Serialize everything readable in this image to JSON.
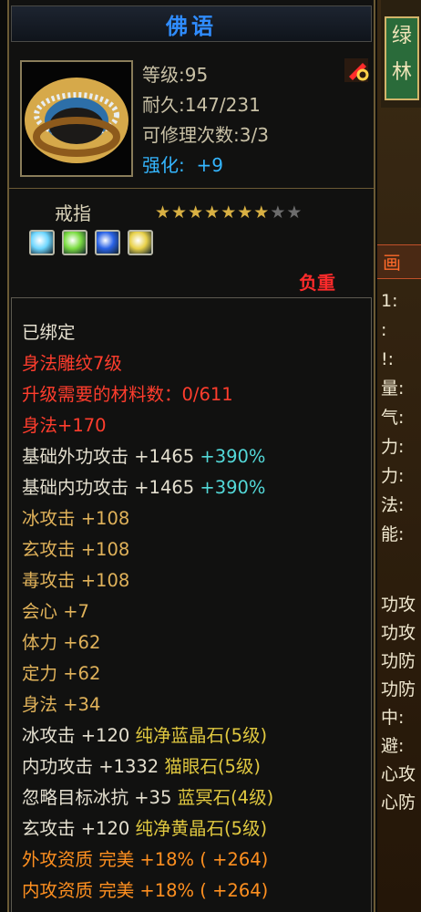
{
  "window": {
    "title": "佛语"
  },
  "item": {
    "level": "等级:95",
    "durability": "耐久:147/231",
    "repair_count": "可修理次数:3/3",
    "enhance_label": "强化:",
    "enhance_value": "+9",
    "type": "戒指",
    "stars": {
      "filled": 7,
      "total": 9
    },
    "bound_status": "负重",
    "gems": [
      {
        "name": "ice-gem-icon",
        "color": "#6fd7ff"
      },
      {
        "name": "green-gem-icon",
        "color": "#7bdc42"
      },
      {
        "name": "blue-gem-icon",
        "color": "#2a63e6"
      },
      {
        "name": "yellow-gem-icon",
        "color": "#e8d14a"
      }
    ]
  },
  "attributes": [
    {
      "parts": [
        {
          "text": "已绑定",
          "color": "w"
        }
      ]
    },
    {
      "parts": [
        {
          "text": "身法雕纹7级",
          "color": "r"
        }
      ]
    },
    {
      "parts": [
        {
          "text": "升级需要的材料数：0/611",
          "color": "r"
        }
      ]
    },
    {
      "parts": [
        {
          "text": "身法+170",
          "color": "r"
        }
      ]
    },
    {
      "parts": [
        {
          "text": "基础外功攻击 +1465 ",
          "color": "w"
        },
        {
          "text": "+390%",
          "color": "c"
        }
      ]
    },
    {
      "parts": [
        {
          "text": "基础内功攻击 +1465 ",
          "color": "w"
        },
        {
          "text": "+390%",
          "color": "c"
        }
      ]
    },
    {
      "parts": [
        {
          "text": "冰攻击 +108",
          "color": "y"
        }
      ]
    },
    {
      "parts": [
        {
          "text": "玄攻击 +108",
          "color": "y"
        }
      ]
    },
    {
      "parts": [
        {
          "text": "毒攻击 +108",
          "color": "y"
        }
      ]
    },
    {
      "parts": [
        {
          "text": "会心 +7",
          "color": "y"
        }
      ]
    },
    {
      "parts": [
        {
          "text": "体力 +62",
          "color": "y"
        }
      ]
    },
    {
      "parts": [
        {
          "text": "定力 +62",
          "color": "y"
        }
      ]
    },
    {
      "parts": [
        {
          "text": "身法 +34",
          "color": "y"
        }
      ]
    },
    {
      "parts": [
        {
          "text": "冰攻击 +120 ",
          "color": "w"
        },
        {
          "text": "纯净蓝晶石(5级)",
          "color": "g"
        }
      ]
    },
    {
      "parts": [
        {
          "text": "内功攻击 +1332 ",
          "color": "w"
        },
        {
          "text": "猫眼石(5级)",
          "color": "g"
        }
      ]
    },
    {
      "parts": [
        {
          "text": "忽略目标冰抗 +35 ",
          "color": "w"
        },
        {
          "text": "蓝冥石(4级)",
          "color": "g"
        }
      ]
    },
    {
      "parts": [
        {
          "text": "玄攻击 +120 ",
          "color": "w"
        },
        {
          "text": "纯净黄晶石(5级)",
          "color": "g"
        }
      ]
    },
    {
      "parts": [
        {
          "text": "外攻资质   完美 +18% ( +264)",
          "color": "o"
        }
      ]
    },
    {
      "parts": [
        {
          "text": "内攻资质   完美 +18% ( +264)",
          "color": "o"
        }
      ]
    }
  ],
  "side": {
    "sign": "绿林",
    "banner": "画",
    "labels_top": [
      "1:",
      ":",
      "!:",
      "量:",
      "气:",
      "力:",
      "力:",
      "法:",
      "能:"
    ],
    "labels_bottom": [
      "功攻",
      "功攻",
      "功防",
      "功防",
      "中:",
      "避:",
      "心攻",
      "心防"
    ]
  },
  "colors": {
    "accent_blue": "#2f8cff",
    "bound_red": "#ff2b2b",
    "gold": "#d8b043"
  }
}
